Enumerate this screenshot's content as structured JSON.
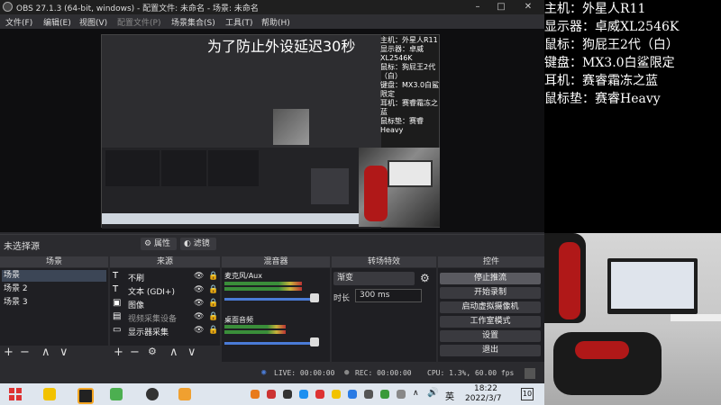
{
  "window": {
    "title": "OBS 27.1.3 (64-bit, windows) - 配置文件: 未命名 - 场景: 未命名",
    "controls": [
      "–",
      "□",
      "✕"
    ]
  },
  "menu": [
    "文件(F)",
    "编辑(E)",
    "视图(V)",
    "配置文件(P)",
    "场景集合(S)",
    "工具(T)",
    "帮助(H)"
  ],
  "preview": {
    "overlay_text": "为了防止外设延迟30秒",
    "mini_specs": [
      "主机：外星人R11",
      "显示器：卓威XL2546K",
      "鼠标：狗屁王2代（白）",
      "键盘：MX3.0白鲨限定",
      "耳机：赛睿霜冻之蓝",
      "鼠标垫：赛睿Heavy"
    ]
  },
  "source_bar": {
    "no_source": "未选择源",
    "properties": "属性",
    "filters": "滤镜"
  },
  "docks": {
    "scenes": {
      "title": "场景",
      "items": [
        "场景",
        "场景 2",
        "场景 3"
      ]
    },
    "sources": {
      "title": "来源",
      "items": [
        {
          "icon": "T",
          "label": "不刷"
        },
        {
          "icon": "T",
          "label": "文本 (GDI+)"
        },
        {
          "icon": "▣",
          "label": "图像"
        },
        {
          "icon": "▤",
          "label": "视频采集设备"
        },
        {
          "icon": "▭",
          "label": "显示器采集"
        }
      ]
    },
    "mixer": {
      "title": "混音器",
      "channels": [
        {
          "name": "麦克风/Aux",
          "level": 0.78
        },
        {
          "name": "桌面音频",
          "level": 0.62
        }
      ]
    },
    "transitions": {
      "title": "转场特效",
      "type": "渐变",
      "duration_label": "时长",
      "duration_value": "300 ms"
    },
    "controls": {
      "title": "控件",
      "buttons": [
        "停止推流",
        "开始录制",
        "启动虚拟摄像机",
        "工作室模式",
        "设置",
        "退出"
      ]
    }
  },
  "status": {
    "live": "LIVE: 00:00:00",
    "rec": "REC: 00:00:00",
    "cpu": "CPU: 1.3%, 60.00 fps"
  },
  "taskbar": {
    "time": "18:22",
    "date": "2022/3/7",
    "lang": "英",
    "notif": "10"
  },
  "specs": [
    "主机：外星人R11",
    "显示器：卓威XL2546K",
    "鼠标：狗屁王2代（白）",
    "键盘：MX3.0白鲨限定",
    "耳机：赛睿霜冻之蓝",
    "鼠标垫：赛睿Heavy"
  ],
  "colors": {
    "obs_bg": "#2b2b2f",
    "dock_bg": "#1f1f23",
    "accent_live": "#4a7bd6",
    "taskbar_bg": "#dfe6ee"
  }
}
